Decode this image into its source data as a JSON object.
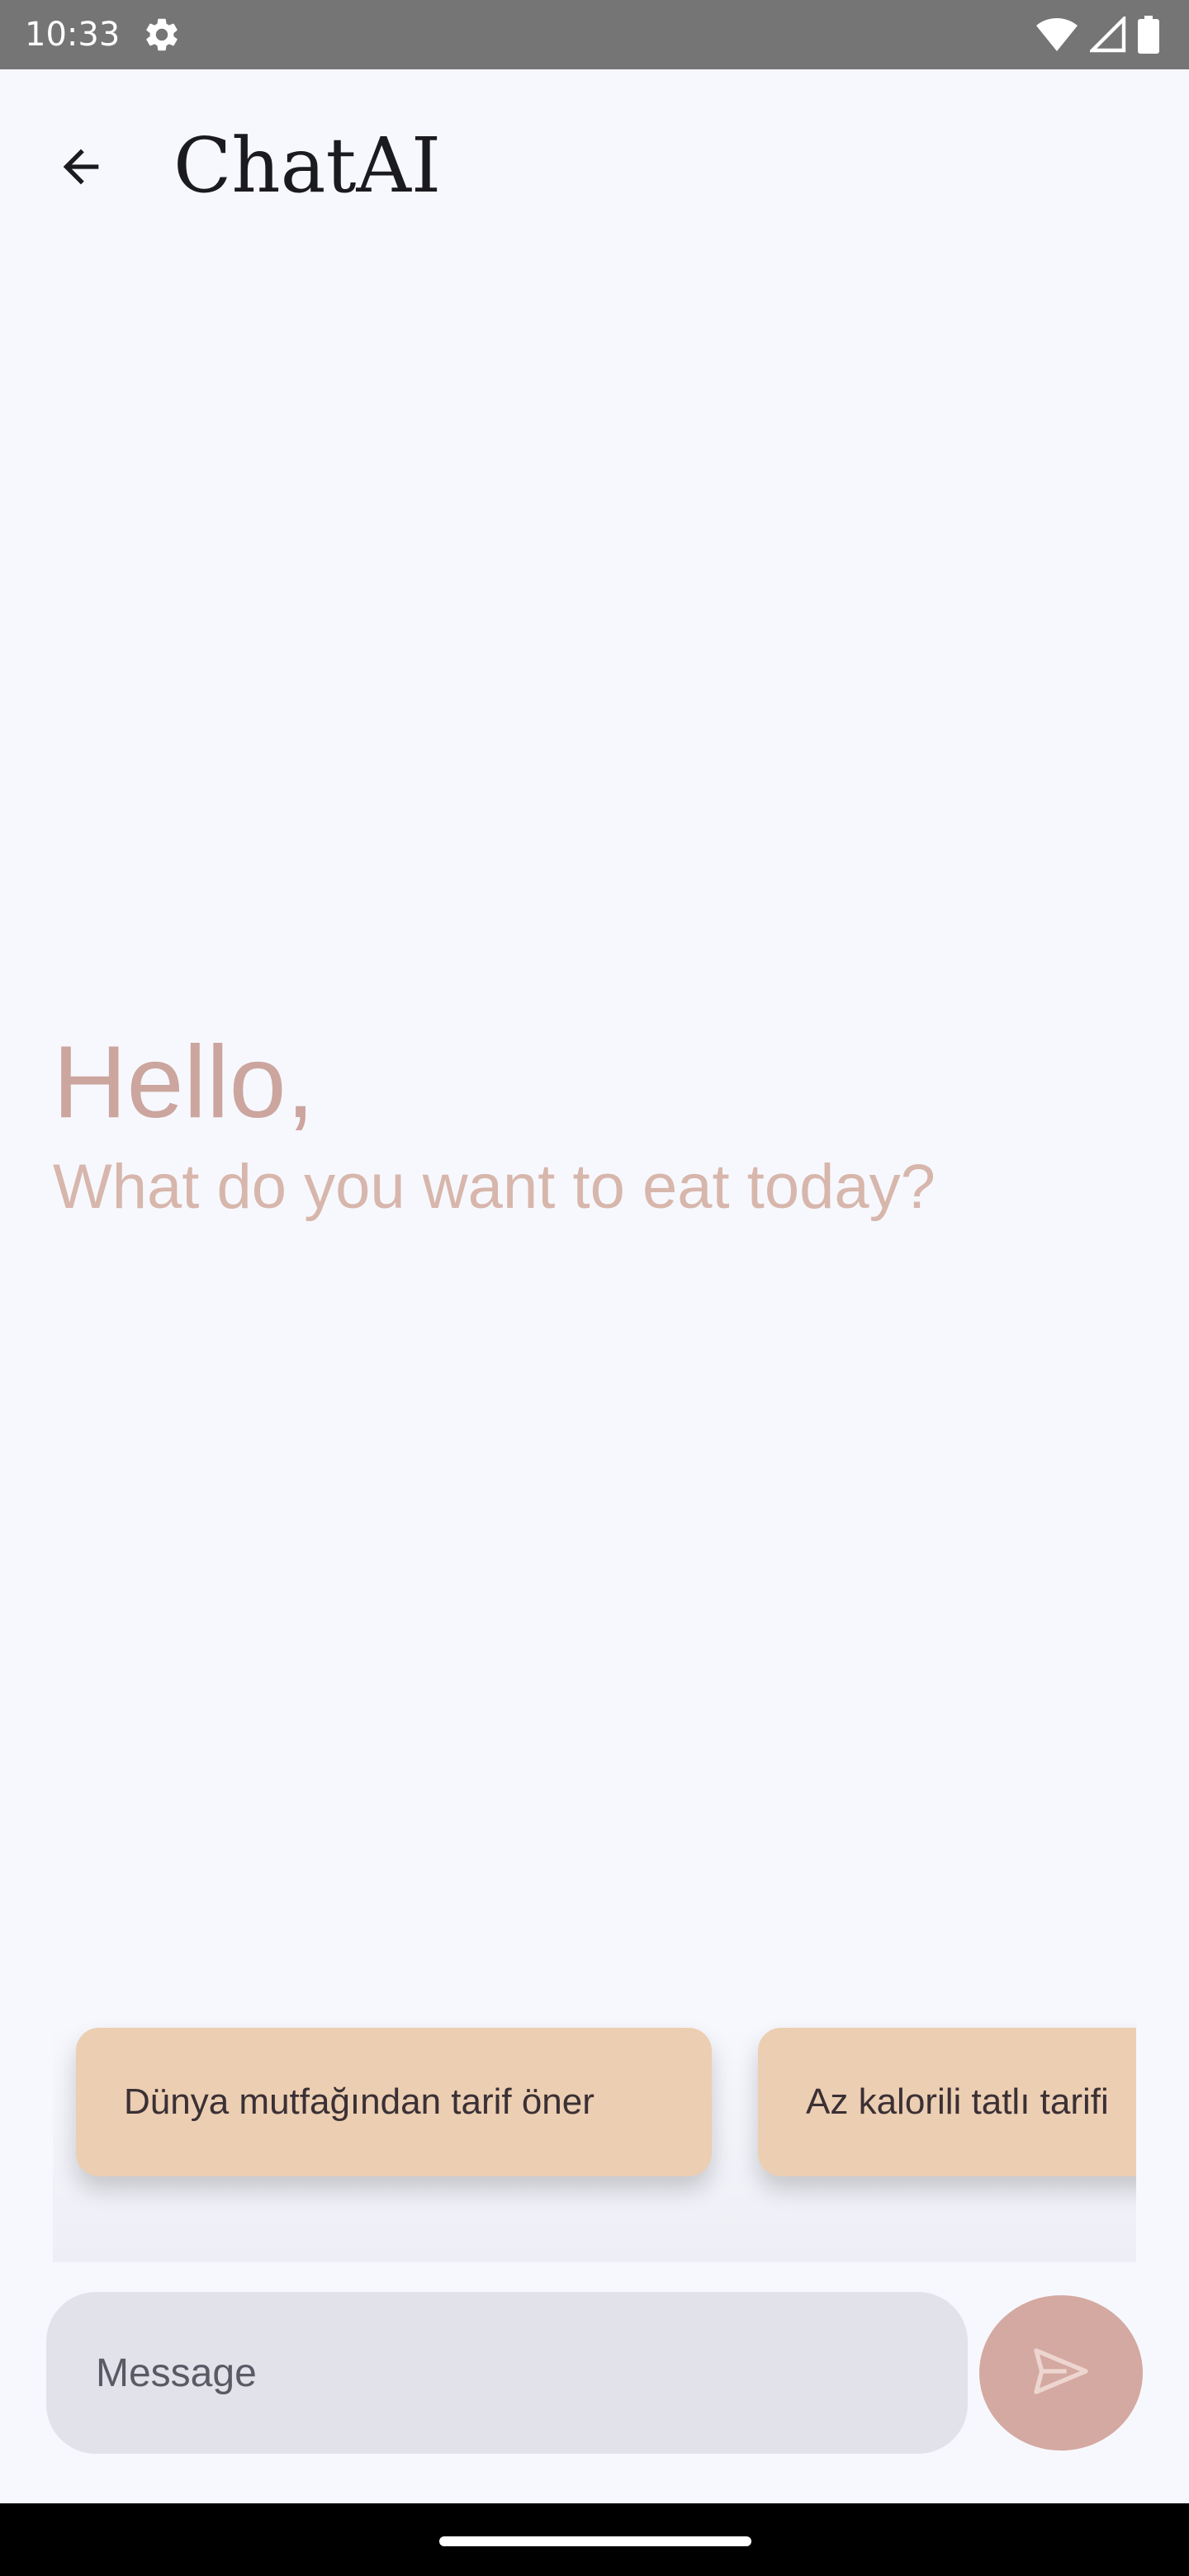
{
  "status_bar": {
    "time": "10:33",
    "icons": [
      "gear-icon",
      "wifi-icon",
      "cellular-signal-icon",
      "battery-icon"
    ]
  },
  "app_bar": {
    "title": "ChatAI",
    "back_icon": "arrow-back-icon"
  },
  "greeting": {
    "hello": "Hello,",
    "subtitle": "What do you want to eat today?"
  },
  "suggestions": [
    {
      "label": "Dünya mutfağından tarif öner"
    },
    {
      "label": "Az kalorili tatlı tarifi"
    }
  ],
  "composer": {
    "placeholder": "Message",
    "value": "",
    "send_icon": "send-icon"
  },
  "colors": {
    "background": "#f7f8fd",
    "accent": "#d4a9a1",
    "chip": "#ecceb2",
    "input": "#e2e2eb"
  }
}
